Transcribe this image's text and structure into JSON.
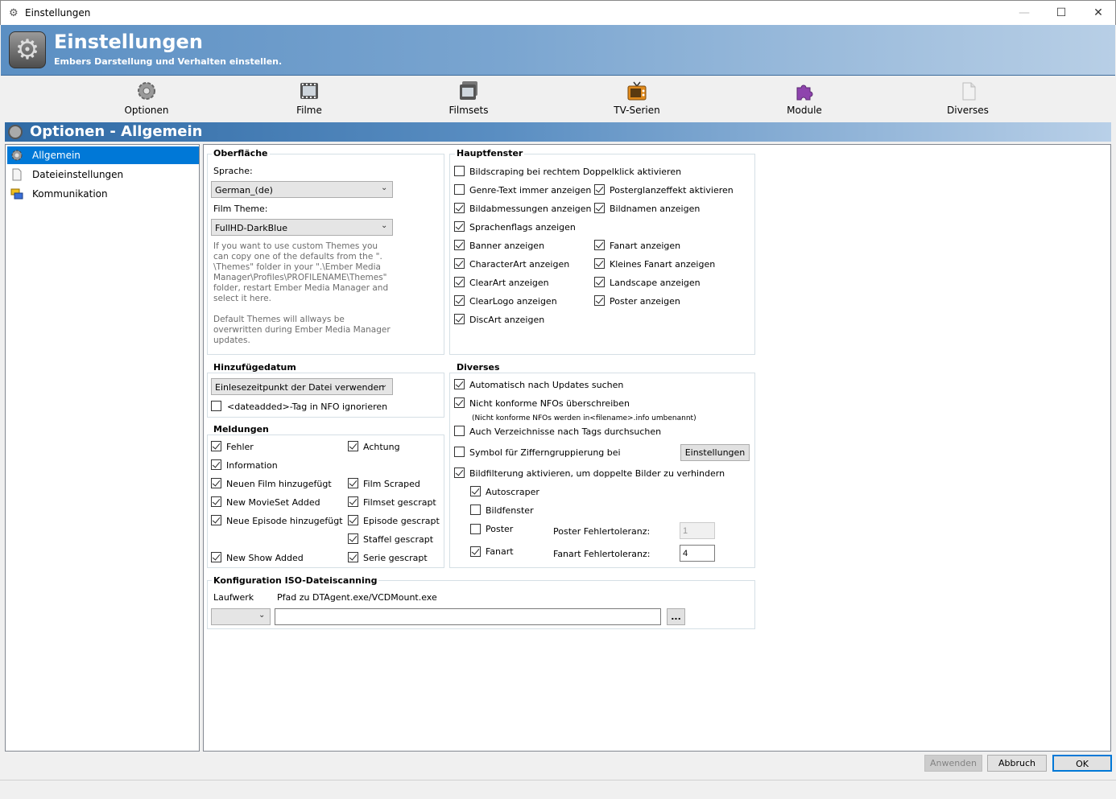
{
  "window": {
    "title": "Einstellungen"
  },
  "banner": {
    "title": "Einstellungen",
    "subtitle": "Embers Darstellung und Verhalten einstellen."
  },
  "toolbar": {
    "items": [
      {
        "label": "Optionen",
        "icon": "gear-icon"
      },
      {
        "label": "Filme",
        "icon": "film-icon"
      },
      {
        "label": "Filmsets",
        "icon": "filmset-icon"
      },
      {
        "label": "TV-Serien",
        "icon": "tv-icon"
      },
      {
        "label": "Module",
        "icon": "puzzle-icon"
      },
      {
        "label": "Diverses",
        "icon": "document-icon"
      }
    ]
  },
  "section": {
    "title": "Optionen - Allgemein"
  },
  "tree": {
    "items": [
      {
        "label": "Allgemein",
        "selected": true
      },
      {
        "label": "Dateieinstellungen"
      },
      {
        "label": "Kommunikation"
      }
    ]
  },
  "oberflaeche": {
    "title": "Oberfläche",
    "sprache_label": "Sprache:",
    "sprache_value": "German_(de)",
    "theme_label": "Film Theme:",
    "theme_value": "FullHD-DarkBlue",
    "hint1": "If you want to use custom Themes you can copy one of the defaults from the \". \\Themes\" folder in your \".\\Ember Media Manager\\Profiles\\PROFILENAME\\Themes\" folder, restart Ember Media Manager and select it here.",
    "hint2": "Default Themes will allways be overwritten during Ember Media Manager updates."
  },
  "hinzufuegedatum": {
    "title": "Hinzufügedatum",
    "value": "Einlesezeitpunkt der Datei verwenden",
    "ignore_label": "<dateadded>-Tag in NFO ignorieren",
    "ignore_checked": false
  },
  "meldungen": {
    "title": "Meldungen",
    "items": [
      {
        "label": "Fehler",
        "checked": true
      },
      {
        "label": "Achtung",
        "checked": true
      },
      {
        "label": "Information",
        "checked": true
      },
      {
        "label": "Neuen Film hinzugefügt",
        "checked": true
      },
      {
        "label": "Film Scraped",
        "checked": true
      },
      {
        "label": "New MovieSet Added",
        "checked": true
      },
      {
        "label": "Filmset gescrapt",
        "checked": true
      },
      {
        "label": "Neue Episode hinzugefügt",
        "checked": true
      },
      {
        "label": "Episode gescrapt",
        "checked": true
      },
      {
        "label": "Staffel gescrapt",
        "checked": true
      },
      {
        "label": "New Show Added",
        "checked": true
      },
      {
        "label": "Serie gescrapt",
        "checked": true
      }
    ]
  },
  "hauptfenster": {
    "title": "Hauptfenster",
    "items": [
      {
        "label": "Bildscraping bei rechtem Doppelklick aktivieren",
        "checked": false
      },
      {
        "label": "Genre-Text immer anzeigen",
        "checked": false
      },
      {
        "label": "Posterglanzeffekt aktivieren",
        "checked": true
      },
      {
        "label": "Bildabmessungen anzeigen",
        "checked": true
      },
      {
        "label": "Bildnamen anzeigen",
        "checked": true
      },
      {
        "label": "Sprachenflags anzeigen",
        "checked": true
      },
      {
        "label": "Banner anzeigen",
        "checked": true
      },
      {
        "label": "Fanart anzeigen",
        "checked": true
      },
      {
        "label": "CharacterArt anzeigen",
        "checked": true
      },
      {
        "label": "Kleines Fanart anzeigen",
        "checked": true
      },
      {
        "label": "ClearArt anzeigen",
        "checked": true
      },
      {
        "label": "Landscape anzeigen",
        "checked": true
      },
      {
        "label": "ClearLogo anzeigen",
        "checked": true
      },
      {
        "label": "Poster anzeigen",
        "checked": true
      },
      {
        "label": "DiscArt anzeigen",
        "checked": true
      }
    ]
  },
  "diverses": {
    "title": "Diverses",
    "updates_label": "Automatisch nach Updates suchen",
    "updates_checked": true,
    "nfo_label": "Nicht konforme NFOs überschreiben",
    "nfo_checked": true,
    "nfo_hint": "(Nicht konforme NFOs werden in<filename>.info umbenannt)",
    "tags_label": "Auch Verzeichnisse nach Tags durchsuchen",
    "tags_checked": false,
    "symbol_label": "Symbol für Zifferngruppierung bei",
    "symbol_checked": false,
    "einstellungen_button": "Einstellungen",
    "filter_label": "Bildfilterung aktivieren, um doppelte Bilder zu verhindern",
    "filter_checked": true,
    "autoscraper_label": "Autoscraper",
    "autoscraper_checked": true,
    "bildfenster_label": "Bildfenster",
    "bildfenster_checked": false,
    "poster_label": "Poster",
    "poster_checked": false,
    "poster_tol_label": "Poster Fehlertoleranz:",
    "poster_tol_value": "1",
    "fanart_label": "Fanart",
    "fanart_checked": true,
    "fanart_tol_label": "Fanart Fehlertoleranz:",
    "fanart_tol_value": "4"
  },
  "iso": {
    "title": "Konfiguration ISO-Dateiscanning",
    "laufwerk_label": "Laufwerk",
    "pfad_label": "Pfad zu DTAgent.exe/VCDMount.exe",
    "laufwerk_value": "",
    "pfad_value": "",
    "browse_button": "..."
  },
  "buttons": {
    "apply": "Anwenden",
    "cancel": "Abbruch",
    "ok": "OK"
  }
}
